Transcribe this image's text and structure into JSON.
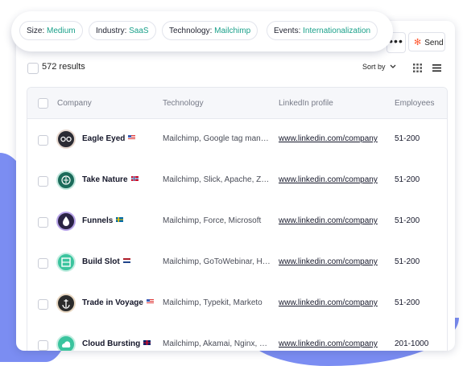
{
  "filters": [
    {
      "key": "Size:",
      "value": "Medium"
    },
    {
      "key": "Industry:",
      "value": "SaaS"
    },
    {
      "key": "Technology:",
      "value": "Mailchimp"
    },
    {
      "key": "Events:",
      "value": "Internationalization"
    }
  ],
  "toolbar": {
    "more_label": "•••",
    "send_label": "Send",
    "results": "572 results",
    "sort_label": "Sort by"
  },
  "table": {
    "headers": [
      "Company",
      "Technology",
      "LinkedIn profile",
      "Employees"
    ],
    "rows": [
      {
        "company": "Eagle Eyed",
        "flag": "US",
        "technology": "Mailchimp, Google tag manager",
        "linkedin": "www.linkedin.com/company",
        "employees": "51-200"
      },
      {
        "company": "Take Nature",
        "flag": "NO",
        "technology": "Mailchimp, Slick, Apache, Zendesk",
        "linkedin": "www.linkedin.com/company",
        "employees": "51-200"
      },
      {
        "company": "Funnels",
        "flag": "SE",
        "technology": "Mailchimp, Force, Microsoft",
        "linkedin": "www.linkedin.com/company",
        "employees": "51-200"
      },
      {
        "company": "Build Slot",
        "flag": "NL",
        "technology": "Mailchimp, GoToWebinar, Hubspot",
        "linkedin": "www.linkedin.com/company",
        "employees": "51-200"
      },
      {
        "company": "Trade in Voyage",
        "flag": "US",
        "technology": "Mailchimp, Typekit, Marketo",
        "linkedin": "www.linkedin.com/company",
        "employees": "51-200"
      },
      {
        "company": "Cloud Bursting",
        "flag": "GB",
        "technology": "Mailchimp, Akamai, Nginx, Hotjar",
        "linkedin": "www.linkedin.com/company",
        "employees": "201-1000"
      }
    ]
  },
  "colors": {
    "accent": "#1aa08a",
    "hubspot": "#ff5c35",
    "blob": "#7b8df2"
  },
  "icons": {
    "logos": [
      "eyes-logo-icon",
      "nature-logo-icon",
      "drop-logo-icon",
      "slot-logo-icon",
      "anchor-logo-icon",
      "cloud-logo-icon"
    ]
  }
}
